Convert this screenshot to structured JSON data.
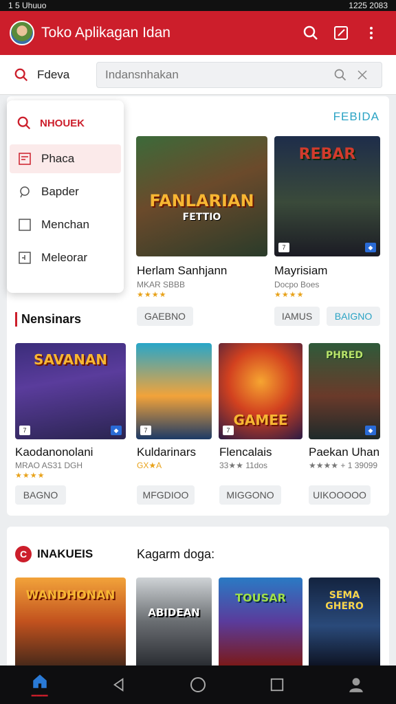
{
  "status": {
    "left": "1 5 Uhuuo",
    "right": "1225 2083"
  },
  "app": {
    "title": "Toko Aplikagan Idan"
  },
  "search": {
    "label": "Fdeva",
    "placeholder": "Indansnhakan"
  },
  "dropdown": {
    "header": "NHOUEK",
    "items": [
      {
        "label": "Phaca",
        "icon": "browser-icon",
        "active": true
      },
      {
        "label": "Bapder",
        "icon": "chat-icon",
        "active": false
      },
      {
        "label": "Menchan",
        "icon": "square-icon",
        "active": false
      },
      {
        "label": "Meleorar",
        "icon": "download-box-icon",
        "active": false
      }
    ]
  },
  "featured": {
    "link": "FEBIDA",
    "games": [
      {
        "name": "Herlam Sanhjann",
        "sub": "MKAR  SBBB",
        "stars": "★★★★",
        "pill": "GAEBNO",
        "art_title": "FANLARIAN",
        "art_sub": "FETTIO"
      },
      {
        "name": "Mayrisiam",
        "sub": "Docpo Boes",
        "stars": "★★★★",
        "pill": "IAMUS",
        "pill2": "BAIGNO",
        "art_title": "REBAR"
      }
    ]
  },
  "section1": {
    "title": "Nensinars",
    "games": [
      {
        "name": "Kaodanonolani",
        "sub": "MRAO  AS31 DGH",
        "stars": "★★★★",
        "pill": "BAGNO",
        "art_title": "SAVANAN"
      },
      {
        "name": "Kuldarinars",
        "sub": "GX★A",
        "stars": "",
        "pill": "MFGDIOO",
        "art_title": ""
      },
      {
        "name": "Flencalais",
        "sub": "33★★  11dos",
        "stars": "",
        "pill": "MIGGONO",
        "art_title": "GAMEE"
      },
      {
        "name": "Paekan Uhan",
        "sub": "★★★★  +  1 39099",
        "stars": "",
        "pill": "UIKOOOOO",
        "art_title": "PHRED"
      }
    ]
  },
  "section2": {
    "title": "INAKUEIS",
    "subtitle": "Kagarm doga:",
    "games": [
      {
        "art_title": "WANDHONAN"
      },
      {
        "art_title": "ABIDEAN"
      },
      {
        "art_title": "TOUSAR"
      },
      {
        "art_title": "SEMA GHERO"
      }
    ]
  },
  "colors": {
    "brand_red": "#cc1e2b",
    "accent_blue": "#2aa3c4",
    "star": "#e8a21a"
  }
}
